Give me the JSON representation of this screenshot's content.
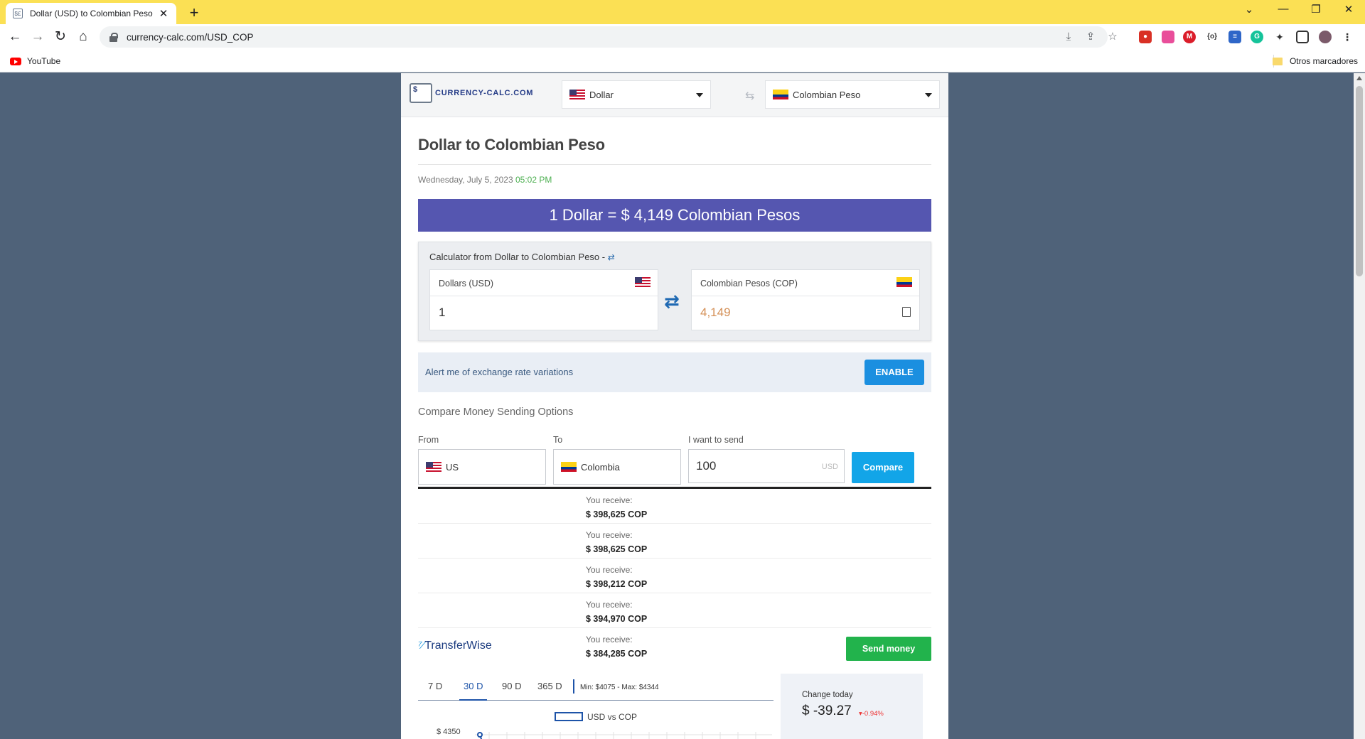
{
  "browser": {
    "tab_title": "Dollar (USD) to Colombian Peso",
    "tab_favicon": "$£",
    "new_tab": "+",
    "url": "currency-calc.com/USD_COP",
    "bookmarks": {
      "youtube": "YouTube",
      "other": "Otros marcadores"
    },
    "controls": {
      "minimize": "—",
      "restore": "❐",
      "close": "✕",
      "tab_list": "⌄"
    }
  },
  "header": {
    "logo_icon": "$",
    "logo_text": "CURRENCY-CALC.COM",
    "from_currency": "Dollar",
    "to_currency": "Colombian Peso",
    "swap_icon": "⇆"
  },
  "main": {
    "title": "Dollar to Colombian Peso",
    "date": "Wednesday, July 5, 2023",
    "time": "05:02 PM",
    "rate_banner": "1 Dollar = $ 4,149 Colombian Pesos"
  },
  "calculator": {
    "title": "Calculator from Dollar to Colombian Peso -",
    "from_label": "Dollars (USD)",
    "from_value": "1",
    "to_label": "Colombian Pesos (COP)",
    "to_value": "4,149"
  },
  "alert": {
    "text": "Alert me of exchange rate variations",
    "button": "ENABLE"
  },
  "compare": {
    "heading": "Compare Money Sending Options",
    "from_label": "From",
    "to_label": "To",
    "send_label": "I want to send",
    "from_value": "US",
    "to_value": "Colombia",
    "amount": "100",
    "unit": "USD",
    "button": "Compare"
  },
  "results": {
    "receive_label": "You receive:",
    "rows": [
      {
        "amount": "$ 398,625 COP"
      },
      {
        "amount": "$ 398,625 COP"
      },
      {
        "amount": "$ 398,212 COP"
      },
      {
        "amount": "$ 394,970 COP"
      },
      {
        "amount": "$ 384,285 COP",
        "provider": "TransferWise",
        "provider_mark": "⁷⁄",
        "button": "Send money"
      }
    ]
  },
  "chart": {
    "tabs": [
      "7 D",
      "30 D",
      "90 D",
      "365 D"
    ],
    "active_tab": "30 D",
    "minmax": "Min: $4075 - Max: $4344",
    "legend": "USD vs COP",
    "ytick": "$ 4350",
    "change_label": "Change today",
    "change_value": "$ -39.27",
    "change_pct": "▾-0.94%",
    "change_color": "#ee3333"
  },
  "colors": {
    "chrome_titlebar": "#fbe054",
    "page_bg": "#4f6279",
    "banner": "#5556b0",
    "enable": "#1b8fe0",
    "compare": "#12a5e8",
    "send_money": "#22b34c"
  }
}
